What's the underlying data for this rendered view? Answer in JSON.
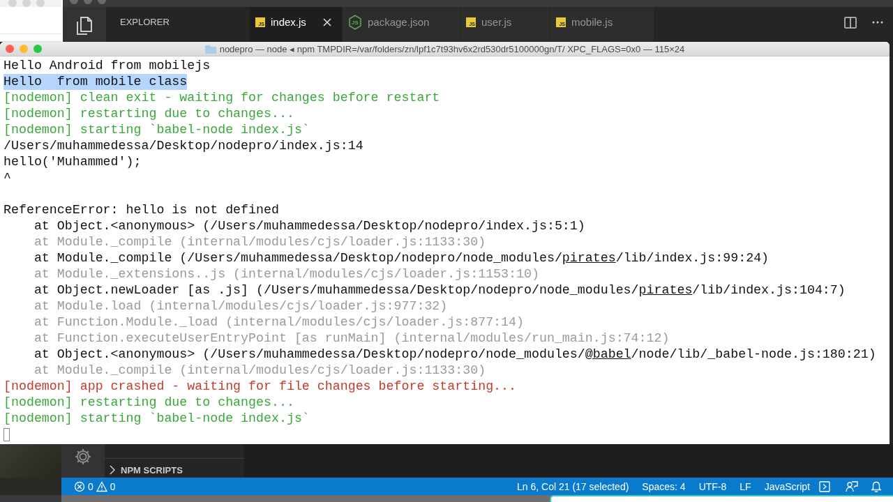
{
  "editor": {
    "sidebar_title": "EXPLORER",
    "tabs": [
      {
        "label": "index.js",
        "kind": "js",
        "icon_label": "JS",
        "selected": true
      },
      {
        "label": "package.json",
        "kind": "node",
        "icon_label": "JS",
        "selected": false
      },
      {
        "label": "user.js",
        "kind": "js",
        "icon_label": "JS",
        "selected": false
      },
      {
        "label": "mobile.js",
        "kind": "js",
        "icon_label": "JS",
        "selected": false
      }
    ]
  },
  "terminal": {
    "title": "nodepro — node ◂ npm TMPDIR=/var/folders/zn/lpf1c7t93hv6x2rd530dr5100000gn/T/ XPC_FLAGS=0x0 — 115×24",
    "lines": [
      {
        "kind": "default",
        "highlighted": false,
        "segments": [
          {
            "text": "Hello Android from mobilejs"
          }
        ]
      },
      {
        "kind": "default",
        "highlighted": true,
        "segments": [
          {
            "text": "Hello  from mobile class"
          }
        ]
      },
      {
        "kind": "info",
        "highlighted": false,
        "segments": [
          {
            "text": "[nodemon] clean exit - waiting for changes before restart"
          }
        ]
      },
      {
        "kind": "info",
        "highlighted": false,
        "segments": [
          {
            "text": "[nodemon] restarting due to changes..."
          }
        ]
      },
      {
        "kind": "info",
        "highlighted": false,
        "segments": [
          {
            "text": "[nodemon] starting `babel-node index.js`"
          }
        ]
      },
      {
        "kind": "default",
        "highlighted": false,
        "segments": [
          {
            "text": "/Users/muhammedessa/Desktop/nodepro/index.js:14"
          }
        ]
      },
      {
        "kind": "default",
        "highlighted": false,
        "segments": [
          {
            "text": "hello('Muhammed');"
          }
        ]
      },
      {
        "kind": "default",
        "highlighted": false,
        "segments": [
          {
            "text": "^"
          }
        ]
      },
      {
        "kind": "blank"
      },
      {
        "kind": "default",
        "highlighted": false,
        "segments": [
          {
            "text": "ReferenceError: hello is not defined"
          }
        ]
      },
      {
        "kind": "default",
        "highlighted": false,
        "segments": [
          {
            "text": "    at Object.<anonymous> (/Users/muhammedessa/Desktop/nodepro/index.js:5:1)"
          }
        ]
      },
      {
        "kind": "dim",
        "highlighted": false,
        "segments": [
          {
            "text": "    at Module._compile (internal/modules/cjs/loader.js:1133:30)"
          }
        ]
      },
      {
        "kind": "default",
        "highlighted": false,
        "segments": [
          {
            "text": "    at Module._compile (/Users/muhammedessa/Desktop/nodepro/node_modules/"
          },
          {
            "text": "pirates",
            "underline": true
          },
          {
            "text": "/lib/index.js:99:24)"
          }
        ]
      },
      {
        "kind": "dim",
        "highlighted": false,
        "segments": [
          {
            "text": "    at Module._extensions..js (internal/modules/cjs/loader.js:1153:10)"
          }
        ]
      },
      {
        "kind": "default",
        "highlighted": false,
        "segments": [
          {
            "text": "    at Object.newLoader [as .js] (/Users/muhammedessa/Desktop/nodepro/node_modules/"
          },
          {
            "text": "pirates",
            "underline": true
          },
          {
            "text": "/lib/index.js:104:7)"
          }
        ]
      },
      {
        "kind": "dim",
        "highlighted": false,
        "segments": [
          {
            "text": "    at Module.load (internal/modules/cjs/loader.js:977:32)"
          }
        ]
      },
      {
        "kind": "dim",
        "highlighted": false,
        "segments": [
          {
            "text": "    at Function.Module._load (internal/modules/cjs/loader.js:877:14)"
          }
        ]
      },
      {
        "kind": "dim",
        "highlighted": false,
        "segments": [
          {
            "text": "    at Function.executeUserEntryPoint [as runMain] (internal/modules/run_main.js:74:12)"
          }
        ]
      },
      {
        "kind": "default",
        "highlighted": false,
        "segments": [
          {
            "text": "    at Object.<anonymous> (/Users/muhammedessa/Desktop/nodepro/node_modules/"
          },
          {
            "text": "@babel",
            "underline": true
          },
          {
            "text": "/node/lib/_babel-node.js:180:21)"
          }
        ]
      },
      {
        "kind": "dim",
        "highlighted": false,
        "segments": [
          {
            "text": "    at Module._compile (internal/modules/cjs/loader.js:1133:30)"
          }
        ]
      },
      {
        "kind": "error",
        "highlighted": false,
        "segments": [
          {
            "text": "[nodemon] app crashed - waiting for file changes before starting..."
          }
        ]
      },
      {
        "kind": "info",
        "highlighted": false,
        "segments": [
          {
            "text": "[nodemon] restarting due to changes..."
          }
        ]
      },
      {
        "kind": "info",
        "highlighted": false,
        "segments": [
          {
            "text": "[nodemon] starting `babel-node index.js`"
          }
        ]
      }
    ]
  },
  "sidebar_section": {
    "label": "NPM SCRIPTS",
    "expanded": false
  },
  "status_bar": {
    "errors": "0",
    "warnings": "0",
    "items": [
      "Ln 6, Col 21 (17 selected)",
      "Spaces: 4",
      "UTF-8",
      "LF",
      "JavaScript"
    ]
  }
}
